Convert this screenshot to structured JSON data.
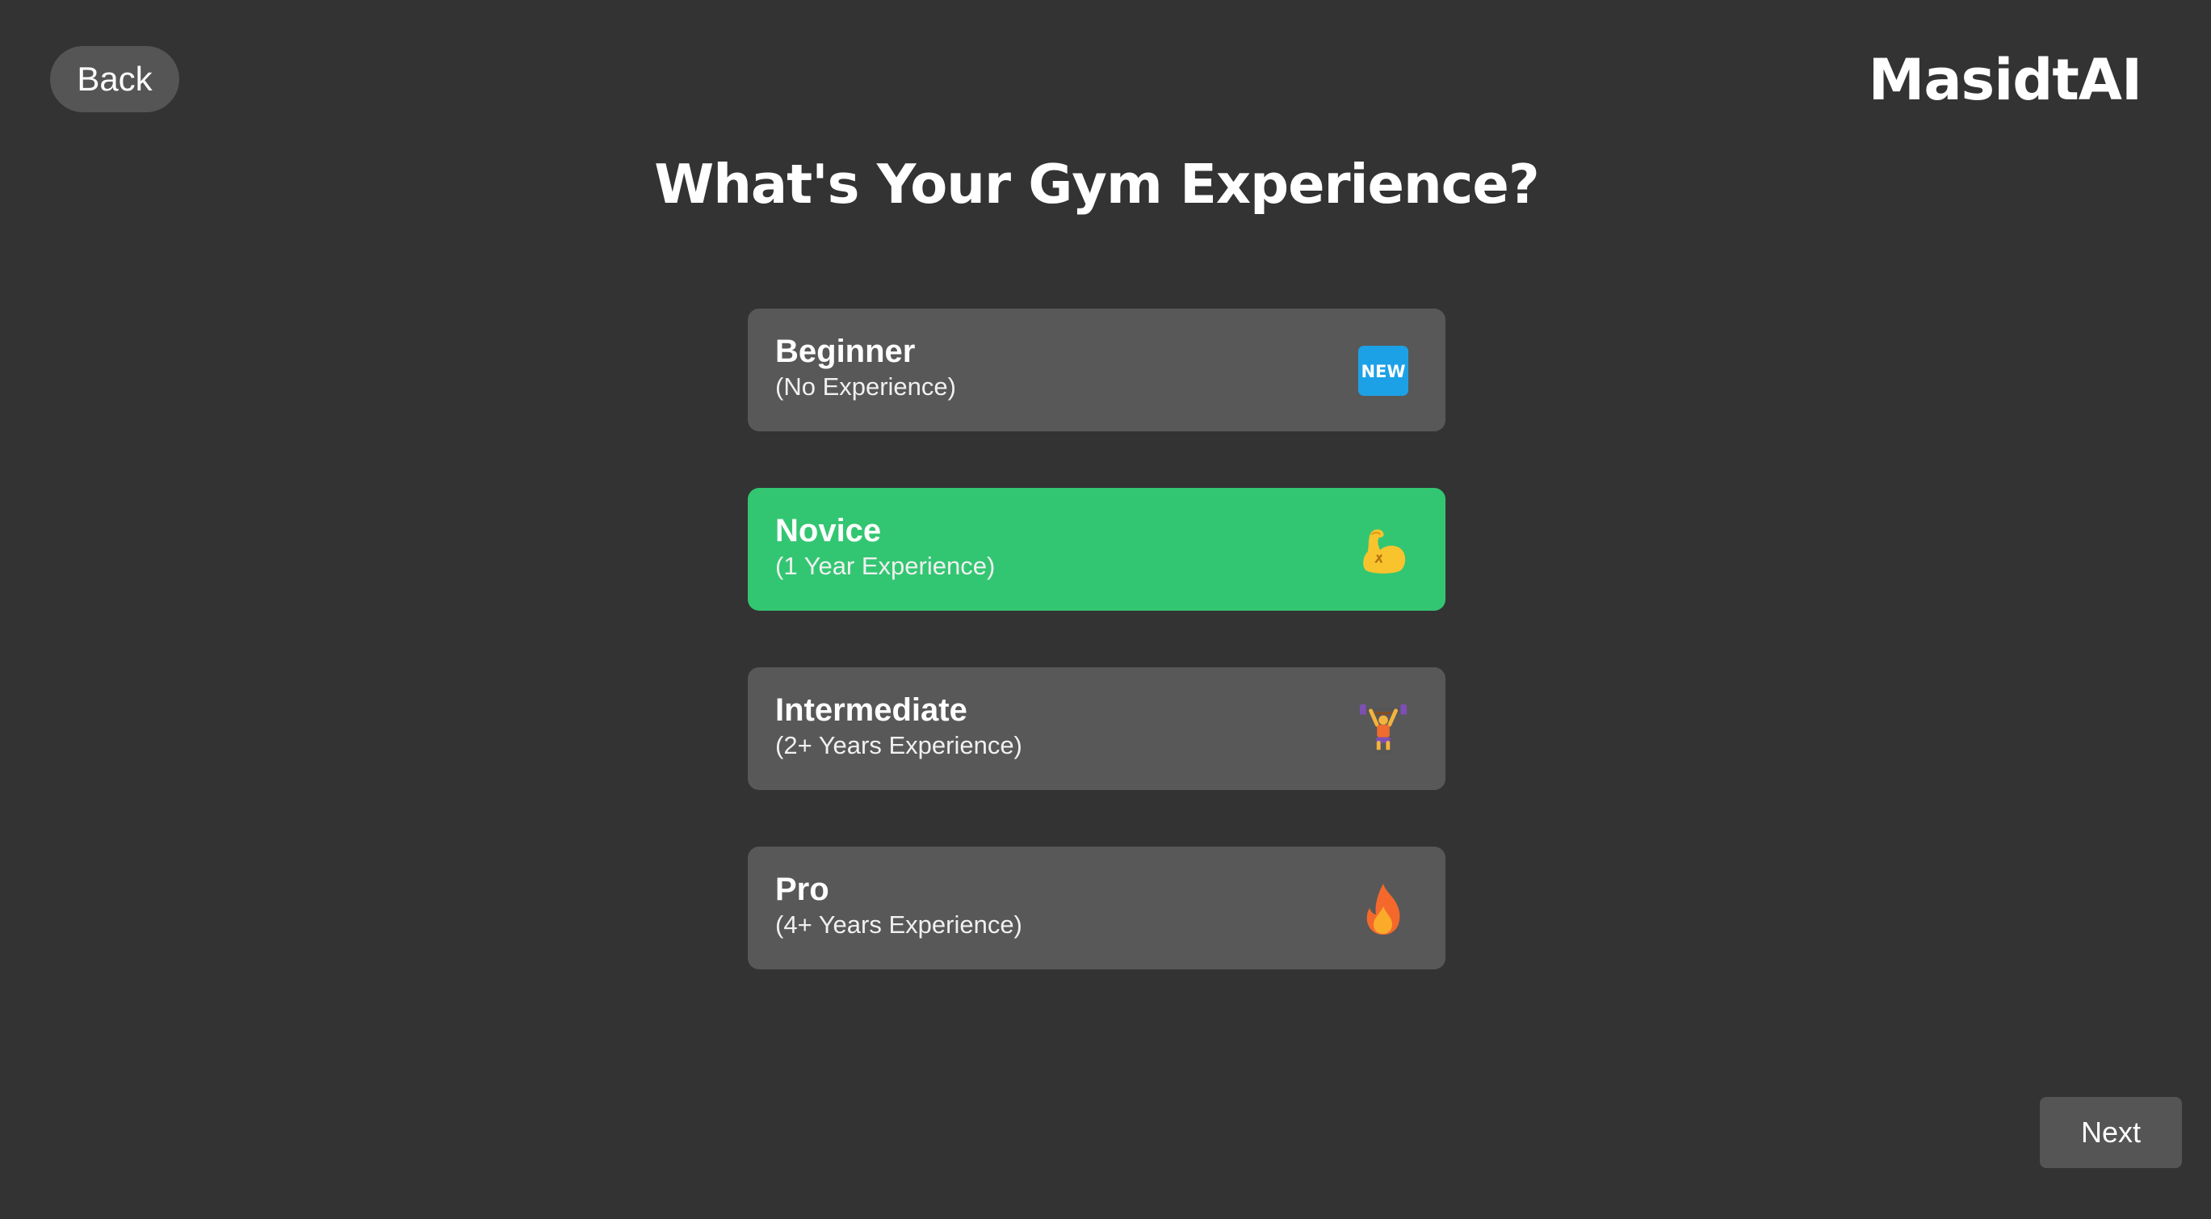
{
  "header": {
    "back_label": "Back",
    "brand": "MasidtAI"
  },
  "page_title": "What's Your Gym Experience?",
  "options": [
    {
      "title": "Beginner",
      "subtitle": "(No Experience)",
      "icon": "new-badge-icon",
      "selected": false
    },
    {
      "title": "Novice",
      "subtitle": "(1 Year Experience)",
      "icon": "flexed-biceps-icon",
      "selected": true
    },
    {
      "title": "Intermediate",
      "subtitle": "(2+ Years Experience)",
      "icon": "weight-lifter-icon",
      "selected": false
    },
    {
      "title": "Pro",
      "subtitle": "(4+ Years Experience)",
      "icon": "fire-icon",
      "selected": false
    }
  ],
  "badge_text": "NEW",
  "footer": {
    "next_label": "Next"
  },
  "colors": {
    "background": "#333333",
    "card": "#585858",
    "selected": "#33c672",
    "button": "#555555"
  }
}
